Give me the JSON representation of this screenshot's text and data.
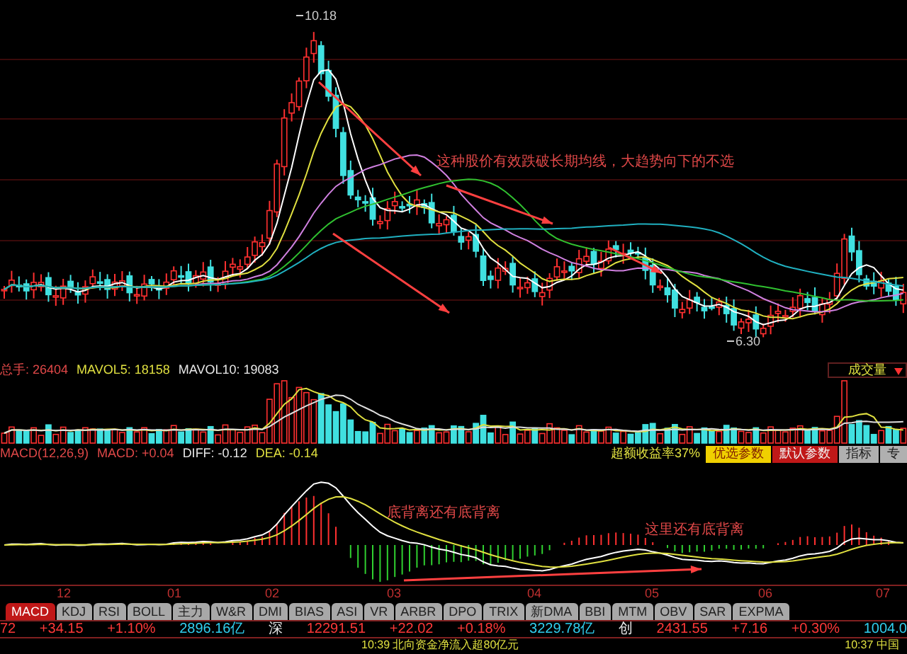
{
  "price_pane": {
    "high_label": "10.18",
    "low_label": "6.30",
    "annotation": "这种股价有效跌破长期均线，大趋势向下的不选"
  },
  "volume_pane": {
    "readouts": [
      {
        "text": "总手: 26404",
        "color": "#e04848"
      },
      {
        "text": "MAVOL5: 18158",
        "color": "#e0e040"
      },
      {
        "text": "MAVOL10: 19083",
        "color": "#e8e8e8"
      }
    ],
    "indicator_dropdown": {
      "label": "成交量",
      "expanded": false
    }
  },
  "macd_pane": {
    "readouts": [
      {
        "text": "MACD(12,26,9)",
        "color": "#e04848"
      },
      {
        "text": "MACD: +0.04",
        "color": "#e04848"
      },
      {
        "text": "DIFF: -0.12",
        "color": "#e8e8e8"
      },
      {
        "text": "DEA: -0.14",
        "color": "#e0e040"
      }
    ],
    "excess_return": "超额收益率37%",
    "buttons": [
      {
        "label": "优选参数",
        "kind": "preferred"
      },
      {
        "label": "默认参数",
        "kind": "default"
      },
      {
        "label": "指标",
        "kind": "plain"
      },
      {
        "label": "专",
        "kind": "plain"
      }
    ],
    "annotations": [
      "底背离还有底背离",
      "这里还有底背离"
    ]
  },
  "date_axis": [
    "12",
    "01",
    "02",
    "03",
    "04",
    "05",
    "06",
    "07"
  ],
  "tabs": [
    {
      "label": "MACD",
      "selected": true
    },
    {
      "label": "KDJ",
      "selected": false
    },
    {
      "label": "RSI",
      "selected": false
    },
    {
      "label": "BOLL",
      "selected": false
    },
    {
      "label": "主力",
      "selected": false
    },
    {
      "label": "W&R",
      "selected": false
    },
    {
      "label": "DMI",
      "selected": false
    },
    {
      "label": "BIAS",
      "selected": false
    },
    {
      "label": "ASI",
      "selected": false
    },
    {
      "label": "VR",
      "selected": false
    },
    {
      "label": "ARBR",
      "selected": false
    },
    {
      "label": "DPO",
      "selected": false
    },
    {
      "label": "TRIX",
      "selected": false
    },
    {
      "label": "新DMA",
      "selected": false
    },
    {
      "label": "BBI",
      "selected": false
    },
    {
      "label": "MTM",
      "selected": false
    },
    {
      "label": "OBV",
      "selected": false
    },
    {
      "label": "SAR",
      "selected": false
    },
    {
      "label": "EXPMA",
      "selected": false
    }
  ],
  "quote_bar": [
    {
      "text": "72",
      "kind": "change"
    },
    {
      "text": "+34.15",
      "kind": "change"
    },
    {
      "text": "+1.10%",
      "kind": "change"
    },
    {
      "text": "2896.16亿",
      "kind": "amount"
    },
    {
      "text": "深",
      "kind": "market"
    },
    {
      "text": "12291.51",
      "kind": "change"
    },
    {
      "text": "+22.02",
      "kind": "change"
    },
    {
      "text": "+0.18%",
      "kind": "change"
    },
    {
      "text": "3229.78亿",
      "kind": "amount"
    },
    {
      "text": "创",
      "kind": "market"
    },
    {
      "text": "2431.55",
      "kind": "change"
    },
    {
      "text": "+7.16",
      "kind": "change"
    },
    {
      "text": "+0.30%",
      "kind": "change"
    },
    {
      "text": "1004.0",
      "kind": "amount"
    }
  ],
  "news_ticker": [
    "10:39 北向资金净流入超80亿元",
    "10:37 中国"
  ]
}
